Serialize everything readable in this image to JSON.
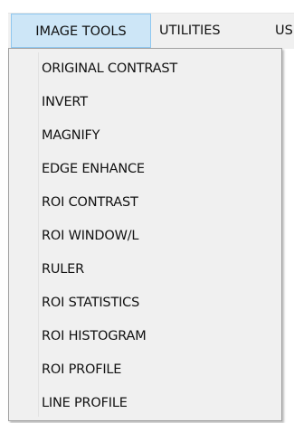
{
  "menubar": {
    "menus": [
      {
        "label": "IMAGE TOOLS",
        "active": true
      },
      {
        "label": "UTILITIES",
        "active": false
      },
      {
        "label": "US",
        "active": false
      }
    ]
  },
  "dropdown": {
    "items": [
      {
        "label": "ORIGINAL CONTRAST"
      },
      {
        "label": "INVERT"
      },
      {
        "label": "MAGNIFY"
      },
      {
        "label": "EDGE ENHANCE"
      },
      {
        "label": "ROI CONTRAST"
      },
      {
        "label": "ROI WINDOW/L"
      },
      {
        "label": "RULER"
      },
      {
        "label": "ROI STATISTICS"
      },
      {
        "label": "ROI HISTOGRAM"
      },
      {
        "label": "ROI PROFILE"
      },
      {
        "label": "LINE PROFILE"
      }
    ]
  },
  "colors": {
    "menubar_bg": "#f0f0f0",
    "active_menu_bg": "#cde6f7",
    "active_menu_border": "#90c8f0",
    "dropdown_border": "#a0a0a0",
    "text": "#111111"
  }
}
